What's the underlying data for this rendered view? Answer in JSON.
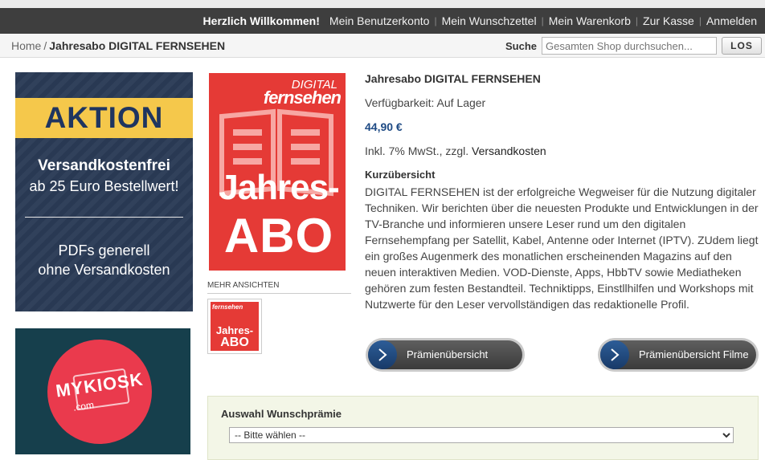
{
  "topnav": {
    "welcome": "Herzlich Willkommen!",
    "items": [
      "Mein Benutzerkonto",
      "Mein Wunschzettel",
      "Mein Warenkorb",
      "Zur Kasse",
      "Anmelden"
    ]
  },
  "breadcrumb": {
    "home": "Home",
    "separator": "/",
    "current": "Jahresabo DIGITAL FERNSEHEN"
  },
  "search": {
    "label": "Suche",
    "placeholder": "Gesamten Shop durchsuchen...",
    "button": "LOS"
  },
  "banner_aktion": {
    "headline": "AKTION",
    "line1": "Versandkostenfrei",
    "line2": "ab 25 Euro Bestellwert!",
    "line3": "PDFs generell",
    "line4": "ohne Versandkosten",
    "colors": {
      "band": "#f5c84b",
      "background": "#2a3b56"
    }
  },
  "banner_mykiosk": {
    "logo_text": "MYKIOSK",
    "logo_sub": ".com",
    "colors": {
      "circle": "#ea3a4d",
      "background": "#163f4c"
    }
  },
  "cover": {
    "brand_top": "DIGITAL",
    "brand_main": "fernsehen",
    "line1": "Jahres-",
    "line2": "ABO",
    "color": "#e53a36"
  },
  "gallery": {
    "label": "MEHR ANSICHTEN",
    "thumb_top": "fernsehen",
    "thumb_line1": "Jahres-",
    "thumb_line2": "ABO"
  },
  "product": {
    "title": "Jahresabo DIGITAL FERNSEHEN",
    "availability": "Verfügbarkeit: Auf Lager",
    "price": "44,90 €",
    "tax_prefix": "Inkl. 7% MwSt., zzgl.",
    "shipping_link": "Versandkosten",
    "summary_heading": "Kurzübersicht",
    "description": "DIGITAL FERNSEHEN ist der erfolgreiche Wegweiser für die Nutzung digitaler Techniken. Wir berichten über die neuesten Produkte und Entwicklungen in der TV-Branche und informieren unsere Leser rund um den digitalen Fernsehempfang per Satellit, Kabel, Antenne oder Internet (IPTV). ZUdem liegt ein großes Augenmerk des monatlichen erscheinenden Magazins auf den neuen interaktiven Medien. VOD-Dienste, Apps, HbbTV sowie Mediatheken gehören zum festen Bestandteil. Techniktipps, Einstllhilfen und Workshops mit Nutzwerte für den Leser vervollständigen das redaktionelle Profil."
  },
  "buttons": {
    "praemien": "Prämienübersicht",
    "praemien_filme": "Prämienübersicht Filme"
  },
  "wunschpraemie": {
    "heading": "Auswahl Wunschprämie",
    "selected": "-- Bitte wählen --"
  }
}
